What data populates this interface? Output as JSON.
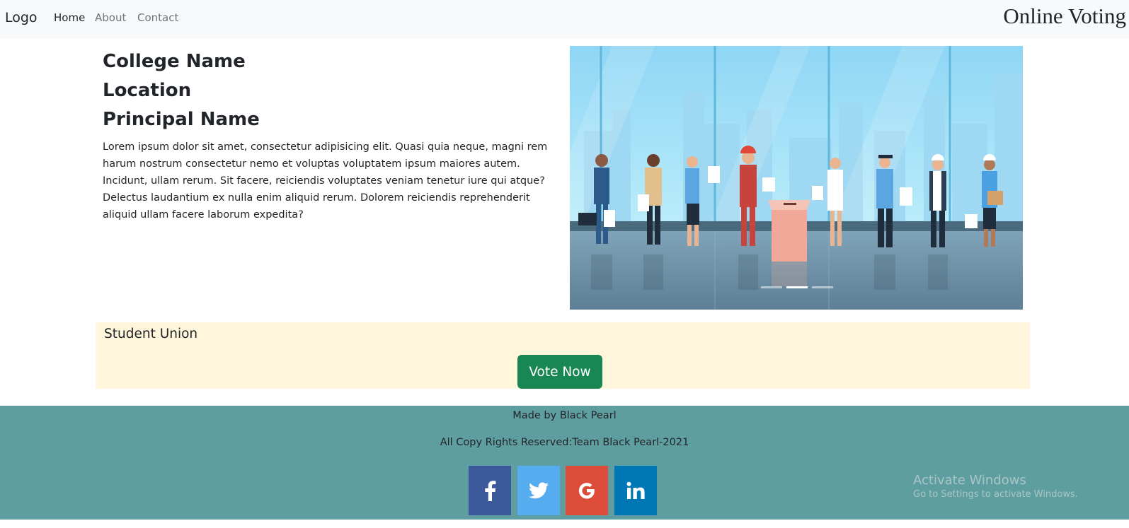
{
  "navbar": {
    "brand": "Logo",
    "links": [
      "Home",
      "About",
      "Contact"
    ],
    "site_title": "Online Voting"
  },
  "college": {
    "name": "College Name",
    "location": "Location",
    "principal": "Principal Name",
    "description": "Lorem ipsum dolor sit amet, consectetur adipisicing elit. Quasi quia neque, magni rem harum nostrum consectetur nemo et voluptas voluptatem ipsum maiores autem. Incidunt, ullam rerum. Sit facere, reiciendis voluptates veniam tenetur iure qui atque? Delectus laudantium ex nulla enim aliquid rerum. Dolorem reiciendis reprehenderit aliquid ullam facere laborum expedita?"
  },
  "carousel": {
    "slide_count": 3,
    "active_slide": 2
  },
  "union": {
    "title": "Student Union",
    "vote_button": "Vote Now"
  },
  "footer": {
    "made_by": "Made by Black Pearl",
    "copyright": "All Copy Rights Reserved:Team Black Pearl-2021",
    "socials": [
      {
        "name": "facebook",
        "icon": "facebook-icon",
        "color": "#3b5998"
      },
      {
        "name": "twitter",
        "icon": "twitter-icon",
        "color": "#55acee"
      },
      {
        "name": "google",
        "icon": "google-icon",
        "color": "#dd4b39"
      },
      {
        "name": "linkedin",
        "icon": "linkedin-icon",
        "color": "#0077b5"
      }
    ]
  },
  "watermark": {
    "title": "Activate Windows",
    "subtitle": "Go to Settings to activate Windows."
  },
  "colors": {
    "navbar_bg": "#f8f9fa",
    "union_bg": "#fff6db",
    "vote_button": "#198754",
    "footer_bg": "#5f9ea0"
  }
}
